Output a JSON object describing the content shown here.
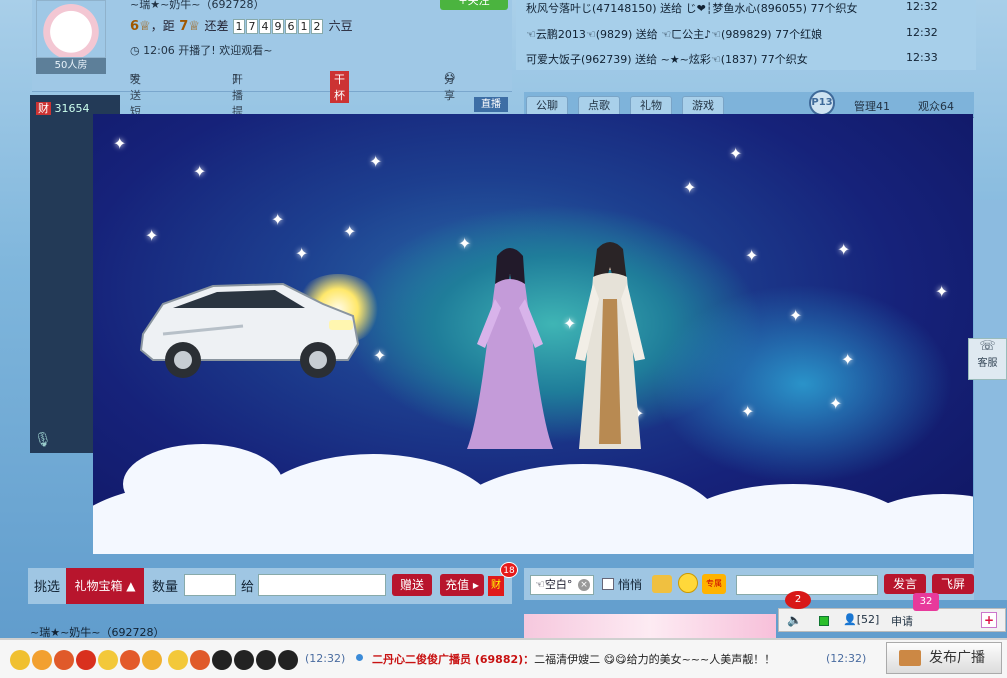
{
  "profile": {
    "fans_label": "50人房",
    "anchor_name": "~瑞★~奶牛~（692728）",
    "level_current": "6",
    "distance_label": "，距",
    "level_next": "7",
    "remaining_label": "还差",
    "bean_digits": [
      "1",
      "7",
      "4",
      "9",
      "6",
      "1",
      "2"
    ],
    "bean_unit": "六豆",
    "live_note": "12:06  开播了! 欢迎观看~",
    "follow_label": "+关注"
  },
  "toolbar": {
    "item1": "发送短信",
    "item2": "开播提醒",
    "item3": "家族",
    "item3_badge": "干杯",
    "item4": "分享"
  },
  "ticker": [
    {
      "text": "秋风兮落叶じ(47148150)  送给  じ❤┆梦鱼水心(896055)  77个织女",
      "time": "12:32"
    },
    {
      "text": "☜云鹏2013☜(9829)  送给  ☜ㄈ公主♪☜(989829)  77个红娘",
      "time": "12:32"
    },
    {
      "text": "可爱大饭子(962739)  送给  ~★~炫彩☜(1837)  77个织女",
      "time": "12:33"
    }
  ],
  "tabs": [
    "公聊",
    "点歌",
    "礼物",
    "游戏"
  ],
  "p13": "P13",
  "managers": "管理41",
  "viewers": "观众64",
  "rich_count": "31654",
  "live_tag": "直播",
  "service_label": "客服",
  "gift_bar": {
    "pick": "挑选",
    "gift_box": "礼物宝箱 ▲",
    "qty_label": "数量",
    "to_label": "给",
    "give": "赠送",
    "recharge": "充值 ▸",
    "cai": "财",
    "cai_badge": "18"
  },
  "chat_bar": {
    "target": "☜空白°",
    "whisper": "悄悄",
    "exclusive": "专属",
    "send": "发言",
    "fly": "飞屏"
  },
  "anchor_bottom": "~瑞★~奶牛~（692728）",
  "status": {
    "speaker_badge": "2",
    "people": "[52]",
    "apply": "申请",
    "apply_badge": "32",
    "plus": "+"
  },
  "broadcast": {
    "time1": "(12:32)",
    "sender": "二丹心二俊俊广播员 (69882)：",
    "body": "二福清伊嫂二 😋😋给力的美女~~~人美声靓！！",
    "time2": "(12:32)",
    "publish": "发布广播"
  },
  "colors": {
    "accent_red": "#b8152d",
    "badge_red": "#d81818",
    "pink": "#e83a9b"
  }
}
